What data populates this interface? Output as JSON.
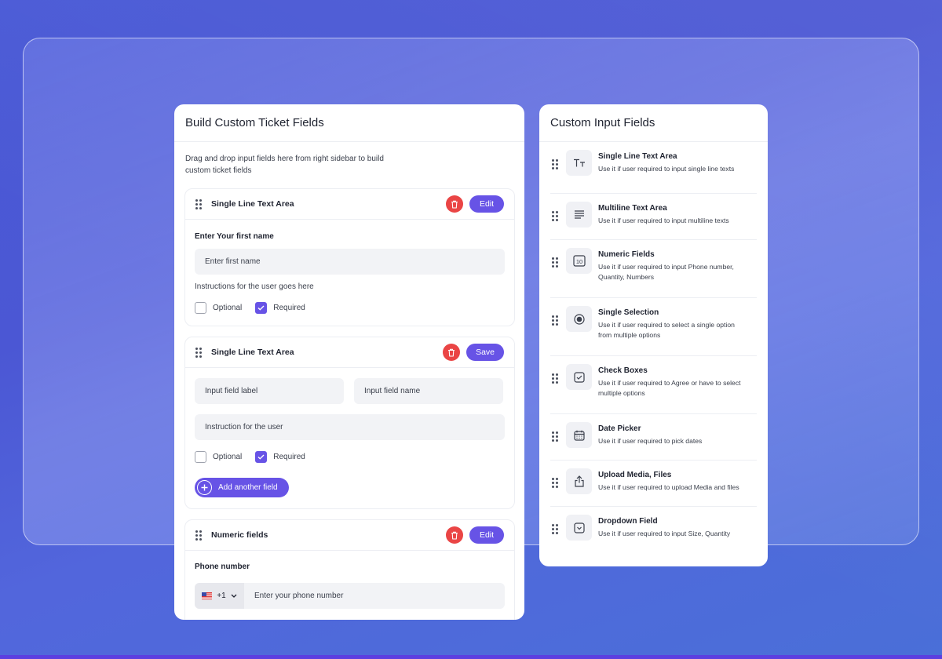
{
  "builder": {
    "title": "Build Custom Ticket Fields",
    "intro": "Drag and drop input fields here from right sidebar to build custom ticket fields",
    "card1": {
      "title": "Single Line Text Area",
      "action_label": "Edit",
      "field_label": "Enter Your first name",
      "placeholder": "Enter first name",
      "instructions": "Instructions for the user goes here",
      "optional_label": "Optional",
      "required_label": "Required"
    },
    "card2": {
      "title": "Single Line Text Area",
      "action_label": "Save",
      "label_placeholder": "Input field label",
      "name_placeholder": "Input field name",
      "instruction_placeholder": "Instruction for the user",
      "optional_label": "Optional",
      "required_label": "Required",
      "add_label": "Add another field"
    },
    "card3": {
      "title": "Numeric fields",
      "action_label": "Edit",
      "field_label": "Phone number",
      "country_code": "+1",
      "placeholder": "Enter your phone number"
    }
  },
  "sidebar": {
    "title": "Custom Input Fields",
    "items": [
      {
        "title": "Single Line Text Area",
        "desc": "Use it if user required to input single line texts",
        "icon": "text-size-icon"
      },
      {
        "title": "Multiline Text Area",
        "desc": "Use it if user required to input multiline texts",
        "icon": "paragraph-icon"
      },
      {
        "title": "Numeric Fields",
        "desc": "Use it if user required to input Phone number, Quantity, Numbers",
        "icon": "number-icon"
      },
      {
        "title": "Single Selection",
        "desc": "Use it if user required to select a single option from multiple options",
        "icon": "radio-icon"
      },
      {
        "title": "Check Boxes",
        "desc": "Use it if user required to Agree or have to select multiple options",
        "icon": "checkbox-icon"
      },
      {
        "title": "Date Picker",
        "desc": "Use it if user required to pick dates",
        "icon": "calendar-icon"
      },
      {
        "title": "Upload Media, Files",
        "desc": "Use it if user required to upload Media and files",
        "icon": "upload-icon"
      },
      {
        "title": "Dropdown Field",
        "desc": "Use it if user required to input Size, Quantity",
        "icon": "dropdown-icon"
      }
    ],
    "number_glyph": "10"
  },
  "colors": {
    "accent": "#6753e6",
    "danger": "#ea4545",
    "background": "#4b57d4"
  }
}
